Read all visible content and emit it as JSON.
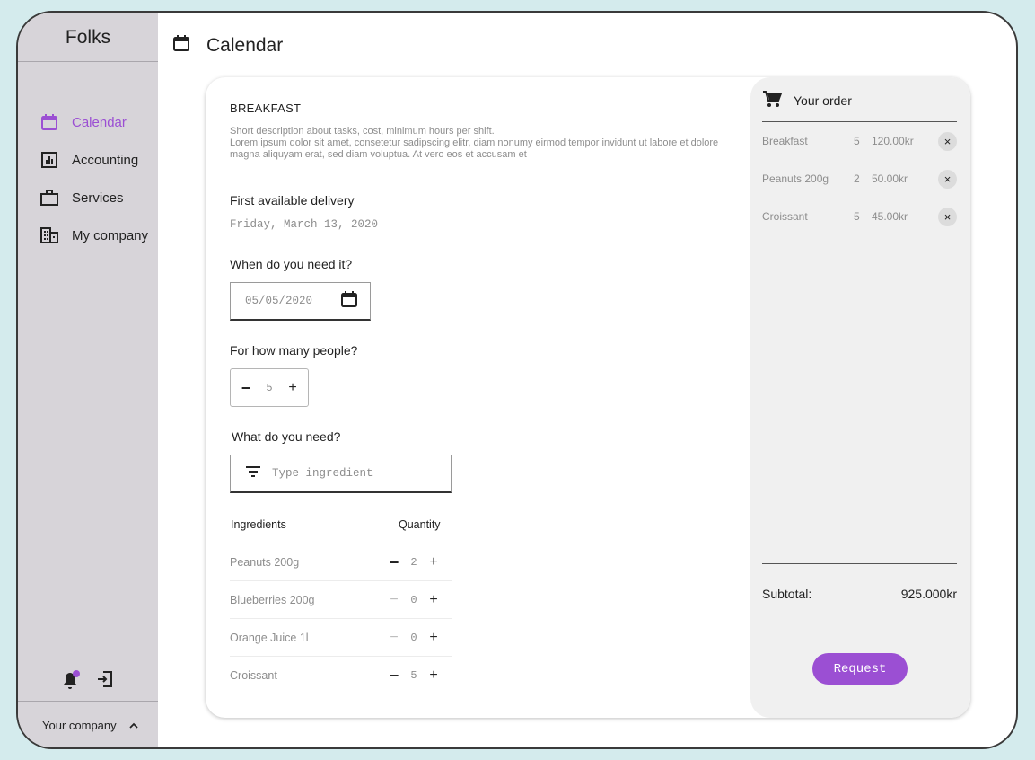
{
  "app": {
    "name": "Folks"
  },
  "sidebar": {
    "items": [
      {
        "label": "Calendar",
        "icon": "calendar-icon",
        "active": true
      },
      {
        "label": "Accounting",
        "icon": "chart-icon",
        "active": false
      },
      {
        "label": "Services",
        "icon": "briefcase-icon",
        "active": false
      },
      {
        "label": "My company",
        "icon": "building-icon",
        "active": false
      }
    ],
    "footer": {
      "company": "Your company"
    }
  },
  "header": {
    "title": "Calendar"
  },
  "form": {
    "section_title": "BREAKFAST",
    "description": "Short description about tasks, cost, minimum hours per shift.\nLorem ipsum dolor sit amet, consetetur sadipscing elitr, diam nonumy eirmod tempor invidunt ut labore et dolore magna aliquyam erat, sed diam voluptua. At vero eos et accusam et",
    "delivery_label": "First available delivery",
    "delivery_date": "Friday, March 13, 2020",
    "when_label": "When do you need it?",
    "date_value": "05/05/2020",
    "people_label": "For how many people?",
    "people_count": "5",
    "need_label": "What do you need?",
    "ingredient_placeholder": "Type ingredient",
    "ingredients_header": "Ingredients",
    "quantity_header": "Quantity",
    "ingredients": [
      {
        "name": "Peanuts 200g",
        "qty": "2"
      },
      {
        "name": "Blueberries 200g",
        "qty": "0"
      },
      {
        "name": "Orange Juice 1l",
        "qty": "0"
      },
      {
        "name": "Croissant",
        "qty": "5"
      }
    ]
  },
  "order": {
    "title": "Your order",
    "items": [
      {
        "name": "Breakfast",
        "count": "5",
        "price": "120.00kr"
      },
      {
        "name": "Peanuts 200g",
        "count": "2",
        "price": "50.00kr"
      },
      {
        "name": "Croissant",
        "count": "5",
        "price": "45.00kr"
      }
    ],
    "subtotal_label": "Subtotal:",
    "subtotal_value": "925.000kr",
    "request_label": "Request"
  },
  "colors": {
    "accent": "#9b4fd3",
    "sidebar_bg": "#d7d4d9",
    "page_bg": "#d4ebed",
    "order_bg": "#f0f0f0"
  }
}
